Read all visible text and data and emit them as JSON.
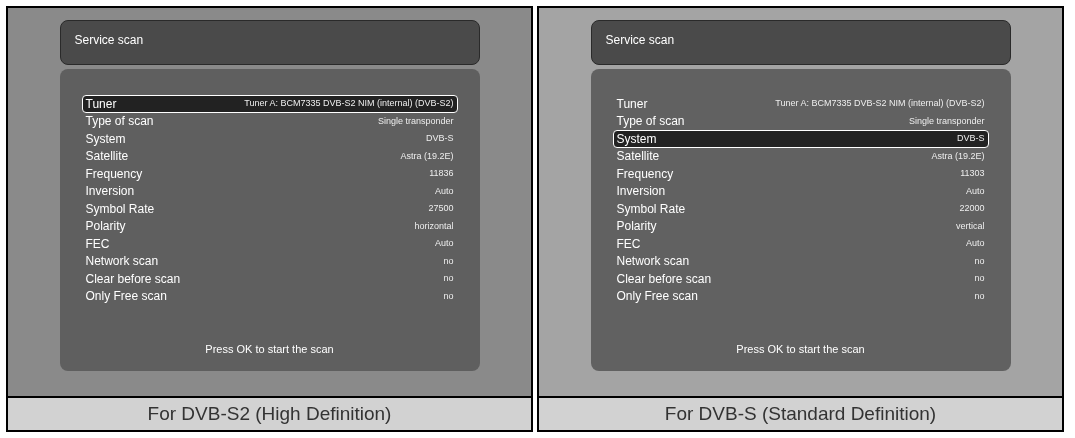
{
  "panels": [
    {
      "title": "Service scan",
      "rows": [
        {
          "label": "Tuner",
          "value": "Tuner A: BCM7335 DVB-S2 NIM (internal) (DVB-S2)",
          "selected": true
        },
        {
          "label": "Type of scan",
          "value": "Single transponder",
          "selected": false
        },
        {
          "label": "System",
          "value": "DVB-S",
          "selected": false
        },
        {
          "label": "Satellite",
          "value": "Astra (19.2E)",
          "selected": false
        },
        {
          "label": "Frequency",
          "value": "11836",
          "selected": false
        },
        {
          "label": "Inversion",
          "value": "Auto",
          "selected": false
        },
        {
          "label": "Symbol Rate",
          "value": "27500",
          "selected": false
        },
        {
          "label": "Polarity",
          "value": "horizontal",
          "selected": false
        },
        {
          "label": "FEC",
          "value": "Auto",
          "selected": false
        },
        {
          "label": "Network scan",
          "value": "no",
          "selected": false
        },
        {
          "label": "Clear before scan",
          "value": "no",
          "selected": false
        },
        {
          "label": "Only Free scan",
          "value": "no",
          "selected": false
        }
      ],
      "hint": "Press OK to start the scan",
      "caption": "For DVB-S2 (High Definition)"
    },
    {
      "title": "Service scan",
      "rows": [
        {
          "label": "Tuner",
          "value": "Tuner A: BCM7335 DVB-S2 NIM (internal) (DVB-S2)",
          "selected": false
        },
        {
          "label": "Type of scan",
          "value": "Single transponder",
          "selected": false
        },
        {
          "label": "System",
          "value": "DVB-S",
          "selected": true
        },
        {
          "label": "Satellite",
          "value": "Astra (19.2E)",
          "selected": false
        },
        {
          "label": "Frequency",
          "value": "11303",
          "selected": false
        },
        {
          "label": "Inversion",
          "value": "Auto",
          "selected": false
        },
        {
          "label": "Symbol Rate",
          "value": "22000",
          "selected": false
        },
        {
          "label": "Polarity",
          "value": "vertical",
          "selected": false
        },
        {
          "label": "FEC",
          "value": "Auto",
          "selected": false
        },
        {
          "label": "Network scan",
          "value": "no",
          "selected": false
        },
        {
          "label": "Clear before scan",
          "value": "no",
          "selected": false
        },
        {
          "label": "Only Free scan",
          "value": "no",
          "selected": false
        }
      ],
      "hint": "Press OK to start the scan",
      "caption": "For DVB-S (Standard Definition)"
    }
  ]
}
